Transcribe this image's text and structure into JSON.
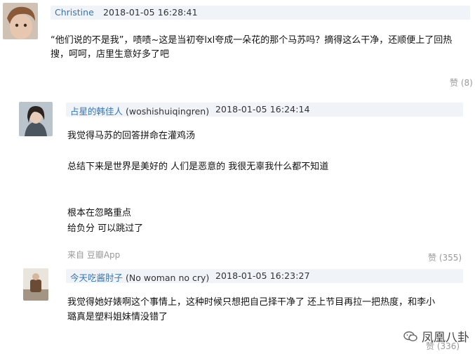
{
  "comments": [
    {
      "author": "Christine",
      "handle": "",
      "time": "2018-01-05 16:28:41",
      "lines": [
        "“他们说的不是我”，啧啧~这是当初夸lxl夸成一朵花的那个马苏吗？摘得这么干净，还顺便上了回热",
        "搜，呵呵，店里生意好多了吧"
      ],
      "likes": "赞 (8)",
      "source": ""
    },
    {
      "author": "占星的韩佳人",
      "handle": "(woshishuiqingren)",
      "time": "2018-01-05 16:24:14",
      "lines": [
        "我觉得马苏的回答拼命在灌鸡汤",
        "总结下来是世界是美好的 人们是恶意的 我很无辜我什么都不知道",
        "根本在忽略重点",
        "给负分 可以跳过了"
      ],
      "likes": "赞 (355)",
      "source_prefix": "来自",
      "source": "豆瓣App"
    },
    {
      "author": "今天吃酱肘子",
      "handle": "(No woman no cry)",
      "time": "2018-01-05 16:23:27",
      "lines": [
        "我觉得她好婊啊这个事情上，这种时候只想把自己择干净了 还上节目再拉一把热度，和李小",
        "璐真是塑料姐妹情没错了"
      ],
      "likes": "赞 (336)",
      "source": ""
    }
  ],
  "watermark": "凤凰八卦",
  "colors": {
    "author": "#3774b8",
    "header_bg": "#f0f3f7",
    "meta": "#999999"
  }
}
